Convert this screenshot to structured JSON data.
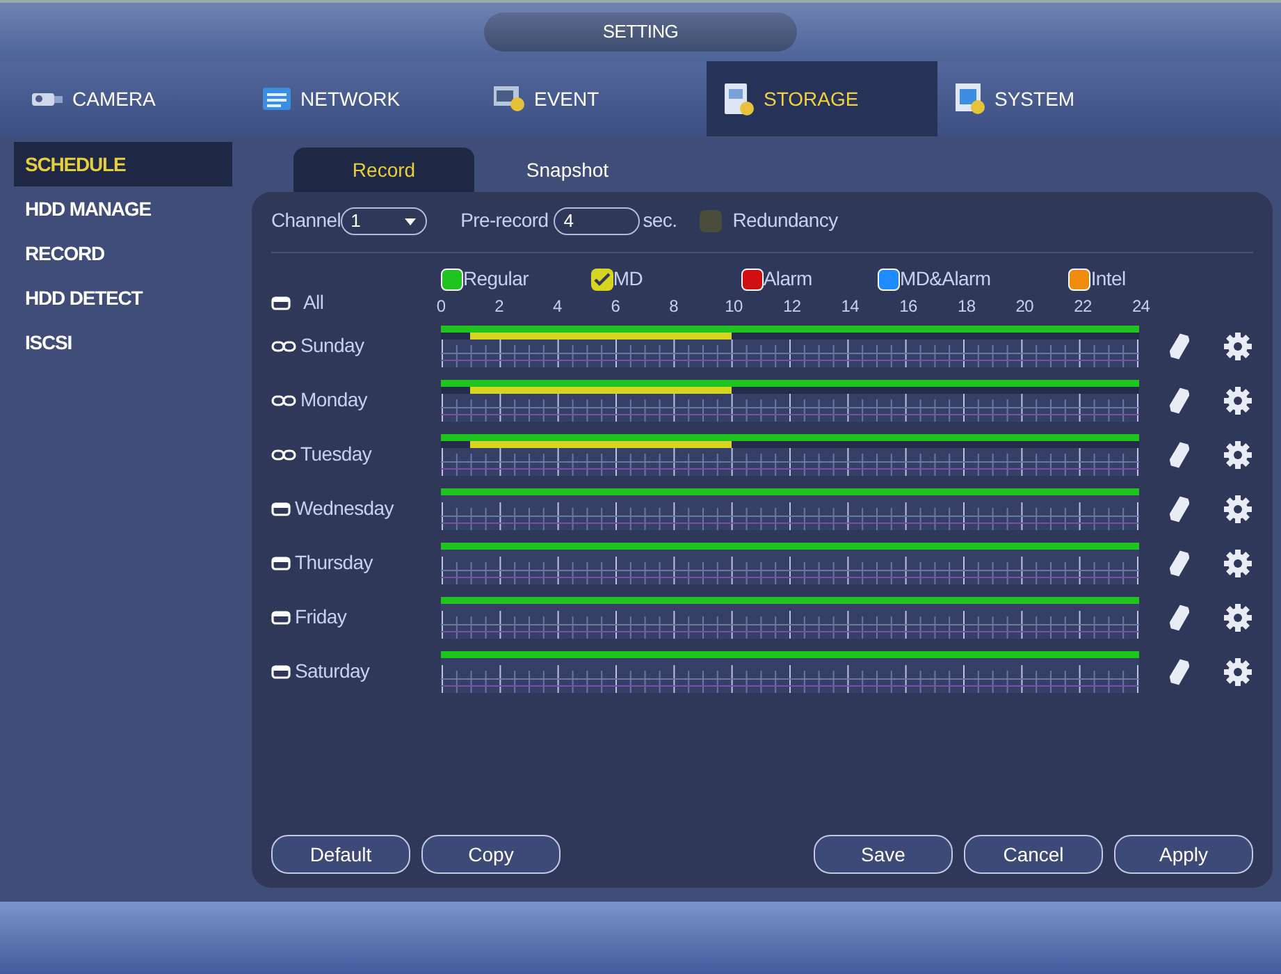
{
  "window": {
    "title": "SETTING"
  },
  "top_tabs": [
    {
      "label": "CAMERA",
      "selected": false
    },
    {
      "label": "NETWORK",
      "selected": false
    },
    {
      "label": "EVENT",
      "selected": false
    },
    {
      "label": "STORAGE",
      "selected": true
    },
    {
      "label": "SYSTEM",
      "selected": false
    }
  ],
  "sidebar": {
    "items": [
      {
        "label": "SCHEDULE",
        "selected": true
      },
      {
        "label": "HDD MANAGE",
        "selected": false
      },
      {
        "label": "RECORD",
        "selected": false
      },
      {
        "label": "HDD DETECT",
        "selected": false
      },
      {
        "label": "ISCSI",
        "selected": false
      }
    ]
  },
  "sub_tabs": [
    {
      "label": "Record",
      "selected": true
    },
    {
      "label": "Snapshot",
      "selected": false
    }
  ],
  "channel": {
    "label": "Channel",
    "value": "1"
  },
  "pre_record": {
    "label": "Pre-record",
    "value": "4",
    "unit": "sec."
  },
  "redundancy": {
    "label": "Redundancy",
    "checked": false
  },
  "all_row": {
    "label": "All",
    "linked": false
  },
  "legend": [
    {
      "label": "Regular",
      "kind": "regular",
      "color": "#1fc41f",
      "checked": false
    },
    {
      "label": "MD",
      "kind": "md",
      "color": "#d7d520",
      "checked": true
    },
    {
      "label": "Alarm",
      "kind": "alarm",
      "color": "#d01010",
      "checked": false
    },
    {
      "label": "MD&Alarm",
      "kind": "mdalarm",
      "color": "#1e8cff",
      "checked": false
    },
    {
      "label": "Intel",
      "kind": "intel",
      "color": "#f08c10",
      "checked": false
    }
  ],
  "hour_ticks": [
    "0",
    "2",
    "4",
    "6",
    "8",
    "10",
    "12",
    "14",
    "16",
    "18",
    "20",
    "22",
    "24"
  ],
  "days": [
    {
      "label": "Sunday",
      "linked": true,
      "tracks": [
        {
          "runs": [
            {
              "kind": "regular",
              "level": 1
            }
          ]
        },
        {
          "runs": [
            {
              "kind": "md",
              "level": 0.4167
            },
            {
              "kind": "none",
              "level": 0.0417
            }
          ]
        }
      ]
    },
    {
      "label": "Monday",
      "linked": true,
      "tracks": [
        {
          "runs": [
            {
              "kind": "regular",
              "level": 1
            }
          ]
        },
        {
          "runs": [
            {
              "kind": "md",
              "level": 0.4167
            },
            {
              "kind": "none",
              "level": 0.0417
            }
          ]
        }
      ]
    },
    {
      "label": "Tuesday",
      "linked": true,
      "tracks": [
        {
          "runs": [
            {
              "kind": "regular",
              "level": 1
            }
          ]
        },
        {
          "runs": [
            {
              "kind": "md",
              "level": 0.4167
            },
            {
              "kind": "none",
              "level": 0.0417
            }
          ]
        }
      ]
    },
    {
      "label": "Wednesday",
      "linked": false,
      "tracks": [
        {
          "runs": [
            {
              "kind": "regular",
              "level": 1
            }
          ]
        }
      ]
    },
    {
      "label": "Thursday",
      "linked": false,
      "tracks": [
        {
          "runs": [
            {
              "kind": "regular",
              "level": 1
            }
          ]
        }
      ]
    },
    {
      "label": "Friday",
      "linked": false,
      "tracks": [
        {
          "runs": [
            {
              "kind": "regular",
              "level": 1
            }
          ]
        }
      ]
    },
    {
      "label": "Saturday",
      "linked": false,
      "tracks": [
        {
          "runs": [
            {
              "kind": "regular",
              "level": 1
            }
          ]
        }
      ]
    }
  ],
  "buttons_left": [
    "Default",
    "Copy"
  ],
  "buttons_right": [
    "Save",
    "Cancel",
    "Apply"
  ]
}
